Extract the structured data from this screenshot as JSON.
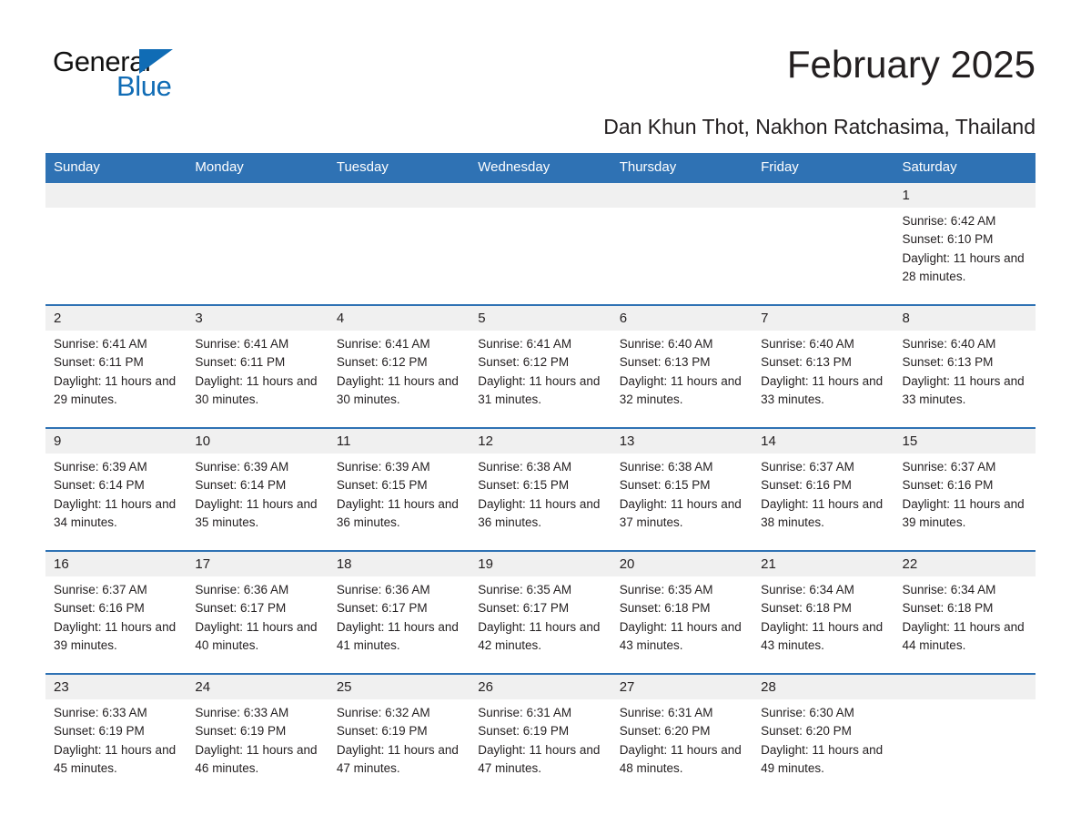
{
  "brand": {
    "name_part1": "General",
    "name_part2": "Blue",
    "accent_color": "#106cb5",
    "logo_icon": "triangle-icon"
  },
  "header": {
    "title": "February 2025",
    "subtitle": "Dan Khun Thot, Nakhon Ratchasima, Thailand"
  },
  "calendar": {
    "header_bg": "#2f72b4",
    "daynum_bg": "#f0f0f0",
    "weekday_headers": [
      "Sunday",
      "Monday",
      "Tuesday",
      "Wednesday",
      "Thursday",
      "Friday",
      "Saturday"
    ],
    "weeks": [
      [
        {
          "day": "",
          "sunrise": "",
          "sunset": "",
          "daylight": ""
        },
        {
          "day": "",
          "sunrise": "",
          "sunset": "",
          "daylight": ""
        },
        {
          "day": "",
          "sunrise": "",
          "sunset": "",
          "daylight": ""
        },
        {
          "day": "",
          "sunrise": "",
          "sunset": "",
          "daylight": ""
        },
        {
          "day": "",
          "sunrise": "",
          "sunset": "",
          "daylight": ""
        },
        {
          "day": "",
          "sunrise": "",
          "sunset": "",
          "daylight": ""
        },
        {
          "day": "1",
          "sunrise": "Sunrise: 6:42 AM",
          "sunset": "Sunset: 6:10 PM",
          "daylight": "Daylight: 11 hours and 28 minutes."
        }
      ],
      [
        {
          "day": "2",
          "sunrise": "Sunrise: 6:41 AM",
          "sunset": "Sunset: 6:11 PM",
          "daylight": "Daylight: 11 hours and 29 minutes."
        },
        {
          "day": "3",
          "sunrise": "Sunrise: 6:41 AM",
          "sunset": "Sunset: 6:11 PM",
          "daylight": "Daylight: 11 hours and 30 minutes."
        },
        {
          "day": "4",
          "sunrise": "Sunrise: 6:41 AM",
          "sunset": "Sunset: 6:12 PM",
          "daylight": "Daylight: 11 hours and 30 minutes."
        },
        {
          "day": "5",
          "sunrise": "Sunrise: 6:41 AM",
          "sunset": "Sunset: 6:12 PM",
          "daylight": "Daylight: 11 hours and 31 minutes."
        },
        {
          "day": "6",
          "sunrise": "Sunrise: 6:40 AM",
          "sunset": "Sunset: 6:13 PM",
          "daylight": "Daylight: 11 hours and 32 minutes."
        },
        {
          "day": "7",
          "sunrise": "Sunrise: 6:40 AM",
          "sunset": "Sunset: 6:13 PM",
          "daylight": "Daylight: 11 hours and 33 minutes."
        },
        {
          "day": "8",
          "sunrise": "Sunrise: 6:40 AM",
          "sunset": "Sunset: 6:13 PM",
          "daylight": "Daylight: 11 hours and 33 minutes."
        }
      ],
      [
        {
          "day": "9",
          "sunrise": "Sunrise: 6:39 AM",
          "sunset": "Sunset: 6:14 PM",
          "daylight": "Daylight: 11 hours and 34 minutes."
        },
        {
          "day": "10",
          "sunrise": "Sunrise: 6:39 AM",
          "sunset": "Sunset: 6:14 PM",
          "daylight": "Daylight: 11 hours and 35 minutes."
        },
        {
          "day": "11",
          "sunrise": "Sunrise: 6:39 AM",
          "sunset": "Sunset: 6:15 PM",
          "daylight": "Daylight: 11 hours and 36 minutes."
        },
        {
          "day": "12",
          "sunrise": "Sunrise: 6:38 AM",
          "sunset": "Sunset: 6:15 PM",
          "daylight": "Daylight: 11 hours and 36 minutes."
        },
        {
          "day": "13",
          "sunrise": "Sunrise: 6:38 AM",
          "sunset": "Sunset: 6:15 PM",
          "daylight": "Daylight: 11 hours and 37 minutes."
        },
        {
          "day": "14",
          "sunrise": "Sunrise: 6:37 AM",
          "sunset": "Sunset: 6:16 PM",
          "daylight": "Daylight: 11 hours and 38 minutes."
        },
        {
          "day": "15",
          "sunrise": "Sunrise: 6:37 AM",
          "sunset": "Sunset: 6:16 PM",
          "daylight": "Daylight: 11 hours and 39 minutes."
        }
      ],
      [
        {
          "day": "16",
          "sunrise": "Sunrise: 6:37 AM",
          "sunset": "Sunset: 6:16 PM",
          "daylight": "Daylight: 11 hours and 39 minutes."
        },
        {
          "day": "17",
          "sunrise": "Sunrise: 6:36 AM",
          "sunset": "Sunset: 6:17 PM",
          "daylight": "Daylight: 11 hours and 40 minutes."
        },
        {
          "day": "18",
          "sunrise": "Sunrise: 6:36 AM",
          "sunset": "Sunset: 6:17 PM",
          "daylight": "Daylight: 11 hours and 41 minutes."
        },
        {
          "day": "19",
          "sunrise": "Sunrise: 6:35 AM",
          "sunset": "Sunset: 6:17 PM",
          "daylight": "Daylight: 11 hours and 42 minutes."
        },
        {
          "day": "20",
          "sunrise": "Sunrise: 6:35 AM",
          "sunset": "Sunset: 6:18 PM",
          "daylight": "Daylight: 11 hours and 43 minutes."
        },
        {
          "day": "21",
          "sunrise": "Sunrise: 6:34 AM",
          "sunset": "Sunset: 6:18 PM",
          "daylight": "Daylight: 11 hours and 43 minutes."
        },
        {
          "day": "22",
          "sunrise": "Sunrise: 6:34 AM",
          "sunset": "Sunset: 6:18 PM",
          "daylight": "Daylight: 11 hours and 44 minutes."
        }
      ],
      [
        {
          "day": "23",
          "sunrise": "Sunrise: 6:33 AM",
          "sunset": "Sunset: 6:19 PM",
          "daylight": "Daylight: 11 hours and 45 minutes."
        },
        {
          "day": "24",
          "sunrise": "Sunrise: 6:33 AM",
          "sunset": "Sunset: 6:19 PM",
          "daylight": "Daylight: 11 hours and 46 minutes."
        },
        {
          "day": "25",
          "sunrise": "Sunrise: 6:32 AM",
          "sunset": "Sunset: 6:19 PM",
          "daylight": "Daylight: 11 hours and 47 minutes."
        },
        {
          "day": "26",
          "sunrise": "Sunrise: 6:31 AM",
          "sunset": "Sunset: 6:19 PM",
          "daylight": "Daylight: 11 hours and 47 minutes."
        },
        {
          "day": "27",
          "sunrise": "Sunrise: 6:31 AM",
          "sunset": "Sunset: 6:20 PM",
          "daylight": "Daylight: 11 hours and 48 minutes."
        },
        {
          "day": "28",
          "sunrise": "Sunrise: 6:30 AM",
          "sunset": "Sunset: 6:20 PM",
          "daylight": "Daylight: 11 hours and 49 minutes."
        },
        {
          "day": "",
          "sunrise": "",
          "sunset": "",
          "daylight": ""
        }
      ]
    ]
  }
}
